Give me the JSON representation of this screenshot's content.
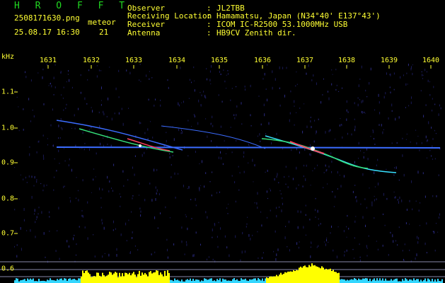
{
  "header": {
    "app_name": "H R O F F T",
    "filename": "2508171630.png",
    "datetime": "25.08.17 16:30",
    "meteor_label": "meteor",
    "meteor_count": "21",
    "info": [
      {
        "key": "Observer",
        "value": "JL2TBB"
      },
      {
        "key": "Receiving Location",
        "value": "Hamamatsu, Japan (N34°40' E137°43')"
      },
      {
        "key": "Receiver",
        "value": "ICOM IC-R2500 53.1000MHz USB"
      },
      {
        "key": "Antenna",
        "value": "HB9CV Zenith dir."
      }
    ]
  },
  "axes": {
    "y_unit": "kHz",
    "x_ticks": [
      "1631",
      "1632",
      "1633",
      "1634",
      "1635",
      "1636",
      "1637",
      "1638",
      "1639",
      "1640"
    ],
    "y_ticks": [
      "1.1",
      "1.0",
      "0.9",
      "0.8",
      "0.7",
      "0.6"
    ]
  },
  "colors": {
    "background": "#000000",
    "text": "#ffff33",
    "logo": "#21d821",
    "grid": "#3a3a8a",
    "carrier": "#3b6cff",
    "trace_cyan": "#38e0ff",
    "trace_green": "#35e07a",
    "trace_red": "#ff4060",
    "trace_white": "#ffffff",
    "power_yellow": "#ffff00",
    "power_cyan": "#33d6ff"
  }
}
